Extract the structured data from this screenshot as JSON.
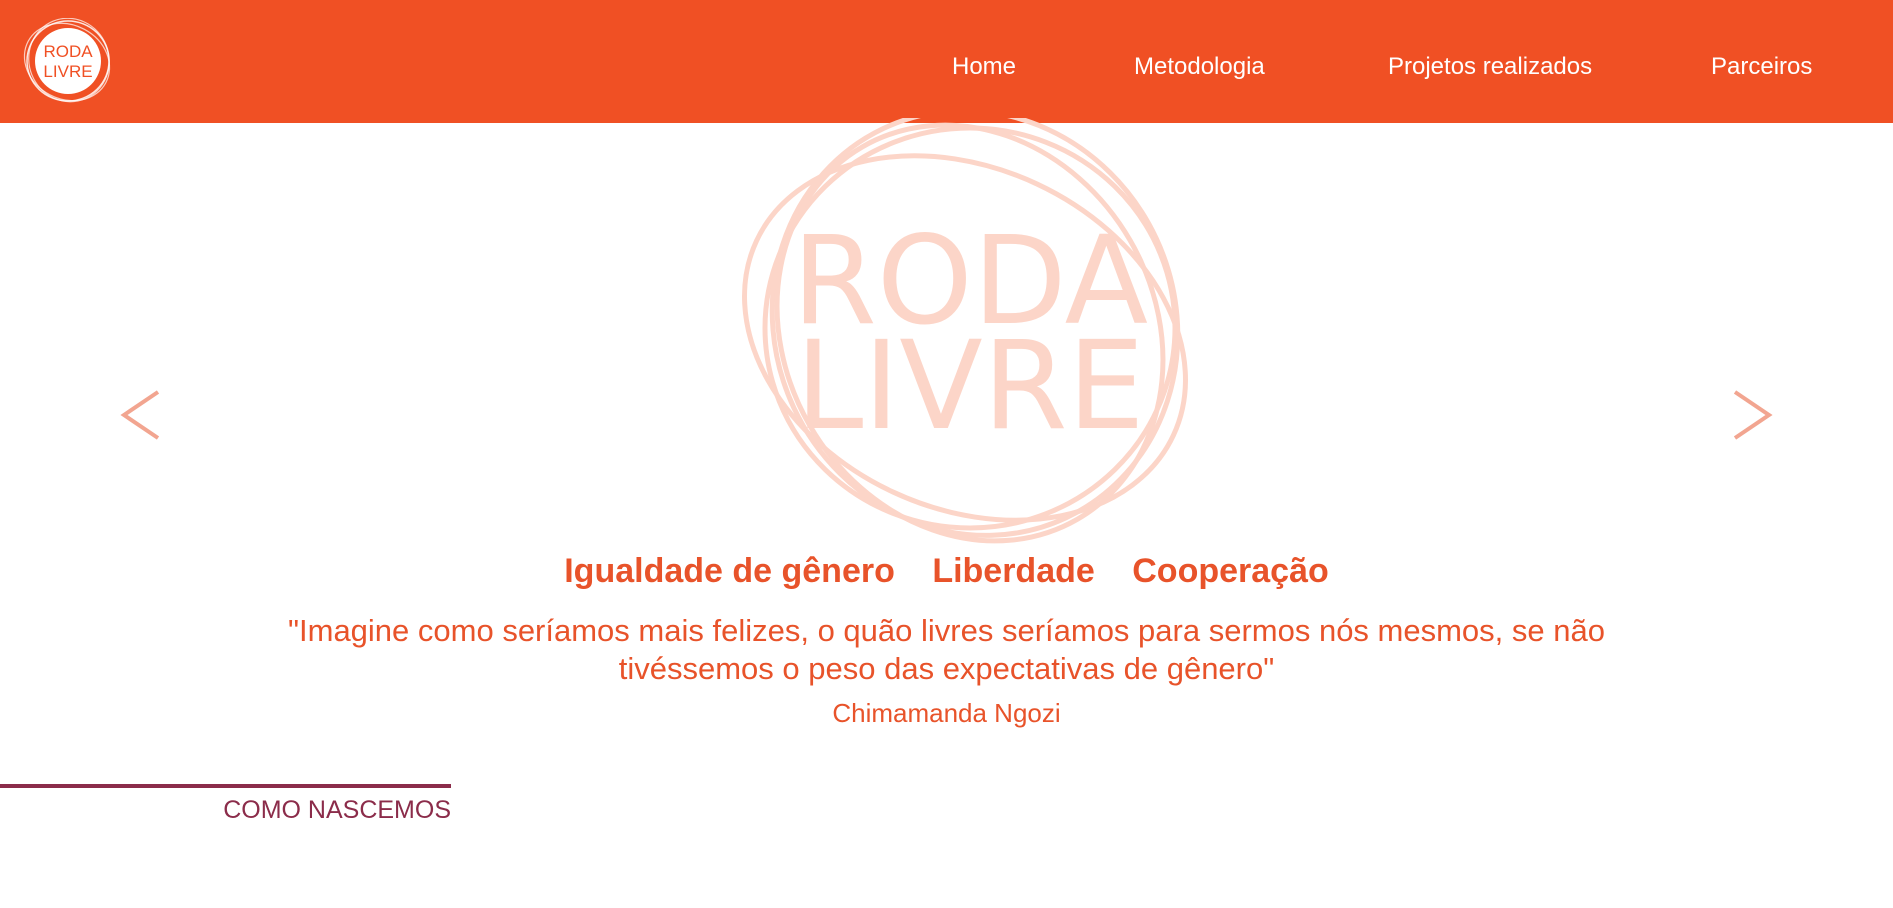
{
  "brand": {
    "logo_line1": "RODA",
    "logo_line2": "LIVRE",
    "primary_color": "#f05024",
    "accent_color": "#8b2c4a"
  },
  "nav": {
    "items": [
      {
        "label": "Home"
      },
      {
        "label": "Metodologia"
      },
      {
        "label": "Projetos realizados"
      },
      {
        "label": "Parceiros"
      }
    ]
  },
  "hero": {
    "prev_icon": "chevron-left-icon",
    "next_icon": "chevron-right-icon",
    "values": [
      "Igualdade de gênero",
      "Liberdade",
      "Cooperação"
    ],
    "quote": "\"Imagine como seríamos mais felizes, o quão livres seríamos para sermos nós mesmos, se não tivéssemos o peso das expectativas de gênero\"",
    "author": "Chimamanda Ngozi"
  },
  "section": {
    "title": "COMO NASCEMOS"
  }
}
